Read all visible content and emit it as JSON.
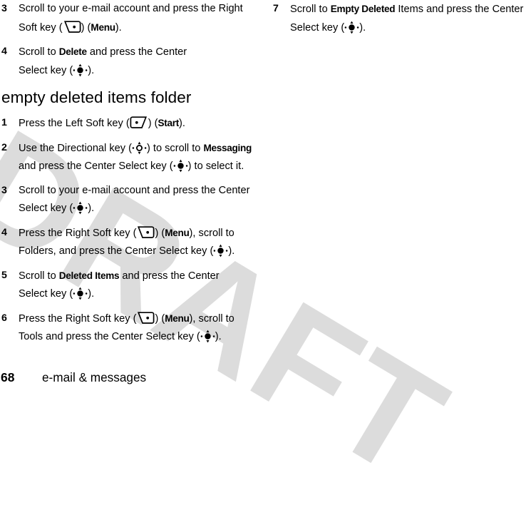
{
  "document": {
    "watermark": "DRAFT",
    "watermark_color": "#dcdcdc",
    "text_color": "#000000",
    "background_color": "#ffffff"
  },
  "footer": {
    "page_number": "68",
    "title": "e-mail & messages"
  },
  "icons": {
    "right_soft_key": "right-soft-key-icon",
    "left_soft_key": "left-soft-key-icon",
    "center_select_key": "center-select-key-icon",
    "directional_key": "directional-key-icon"
  },
  "left_column": {
    "continued_steps": [
      {
        "number": "3",
        "lines": [
          {
            "parts": [
              {
                "t": "Scroll to your e-mail account and press the Right",
                "s": "normal"
              }
            ]
          },
          {
            "parts": [
              {
                "t": "Soft key (",
                "s": "normal"
              },
              {
                "t": "",
                "s": "icon-right-soft"
              },
              {
                "t": ") (",
                "s": "normal"
              },
              {
                "t": "Menu",
                "s": "bold"
              },
              {
                "t": ").",
                "s": "normal"
              }
            ]
          }
        ]
      },
      {
        "number": "4",
        "lines": [
          {
            "parts": [
              {
                "t": "Scroll to ",
                "s": "normal"
              },
              {
                "t": "Delete",
                "s": "bold"
              },
              {
                "t": " and press the Center",
                "s": "normal"
              }
            ]
          },
          {
            "parts": [
              {
                "t": "Select key (",
                "s": "normal"
              },
              {
                "t": "",
                "s": "icon-center-select"
              },
              {
                "t": ").",
                "s": "normal"
              }
            ]
          }
        ]
      }
    ],
    "section": {
      "heading": "empty deleted items folder",
      "steps": [
        {
          "number": "1",
          "lines": [
            {
              "parts": [
                {
                  "t": "Press the Left Soft key (",
                  "s": "normal"
                },
                {
                  "t": "",
                  "s": "icon-left-soft"
                },
                {
                  "t": ") (",
                  "s": "normal"
                },
                {
                  "t": "Start",
                  "s": "bold"
                },
                {
                  "t": ").",
                  "s": "normal"
                }
              ]
            }
          ]
        },
        {
          "number": "2",
          "lines": [
            {
              "parts": [
                {
                  "t": "Use the Directional key (",
                  "s": "normal"
                },
                {
                  "t": "",
                  "s": "icon-directional"
                },
                {
                  "t": ") to scroll to ",
                  "s": "normal"
                },
                {
                  "t": "Messaging",
                  "s": "bold"
                }
              ]
            },
            {
              "parts": [
                {
                  "t": "and press the Center Select key (",
                  "s": "normal"
                },
                {
                  "t": "",
                  "s": "icon-center-select"
                },
                {
                  "t": ") to select it.",
                  "s": "normal"
                }
              ]
            }
          ]
        },
        {
          "number": "3",
          "lines": [
            {
              "parts": [
                {
                  "t": "Scroll to your e-mail account and press the Center",
                  "s": "normal"
                }
              ]
            },
            {
              "parts": [
                {
                  "t": "Select key (",
                  "s": "normal"
                },
                {
                  "t": "",
                  "s": "icon-center-select"
                },
                {
                  "t": ").",
                  "s": "normal"
                }
              ]
            }
          ]
        },
        {
          "number": "4",
          "lines": [
            {
              "parts": [
                {
                  "t": "Press the Right Soft key (",
                  "s": "normal"
                },
                {
                  "t": "",
                  "s": "icon-right-soft"
                },
                {
                  "t": ") (",
                  "s": "normal"
                },
                {
                  "t": "Menu",
                  "s": "bold"
                },
                {
                  "t": "), scroll to",
                  "s": "normal"
                }
              ]
            },
            {
              "parts": [
                {
                  "t": "Folders, and press the Center Select key (",
                  "s": "normal"
                },
                {
                  "t": "",
                  "s": "icon-center-select"
                },
                {
                  "t": ").",
                  "s": "normal"
                }
              ]
            }
          ]
        },
        {
          "number": "5",
          "lines": [
            {
              "parts": [
                {
                  "t": "Scroll to ",
                  "s": "normal"
                },
                {
                  "t": "Deleted Items",
                  "s": "bold"
                },
                {
                  "t": " and press the Center",
                  "s": "normal"
                }
              ]
            },
            {
              "parts": [
                {
                  "t": "Select key (",
                  "s": "normal"
                },
                {
                  "t": "",
                  "s": "icon-center-select"
                },
                {
                  "t": ").",
                  "s": "normal"
                }
              ]
            }
          ]
        },
        {
          "number": "6",
          "lines": [
            {
              "parts": [
                {
                  "t": "Press the Right Soft key (",
                  "s": "normal"
                },
                {
                  "t": "",
                  "s": "icon-right-soft"
                },
                {
                  "t": ") (",
                  "s": "normal"
                },
                {
                  "t": "Menu",
                  "s": "bold"
                },
                {
                  "t": "), scroll to",
                  "s": "normal"
                }
              ]
            },
            {
              "parts": [
                {
                  "t": "Tools and press the Center Select key (",
                  "s": "normal"
                },
                {
                  "t": "",
                  "s": "icon-center-select"
                },
                {
                  "t": ").",
                  "s": "normal"
                }
              ]
            }
          ]
        }
      ]
    }
  },
  "right_column": {
    "steps": [
      {
        "number": "7",
        "lines": [
          {
            "parts": [
              {
                "t": "Scroll to ",
                "s": "normal"
              },
              {
                "t": "Empty Deleted",
                "s": "bold"
              },
              {
                "t": " Items and press the Center",
                "s": "normal"
              }
            ]
          },
          {
            "parts": [
              {
                "t": "Select key (",
                "s": "normal"
              },
              {
                "t": "",
                "s": "icon-center-select"
              },
              {
                "t": ").",
                "s": "normal"
              }
            ]
          }
        ]
      }
    ]
  }
}
